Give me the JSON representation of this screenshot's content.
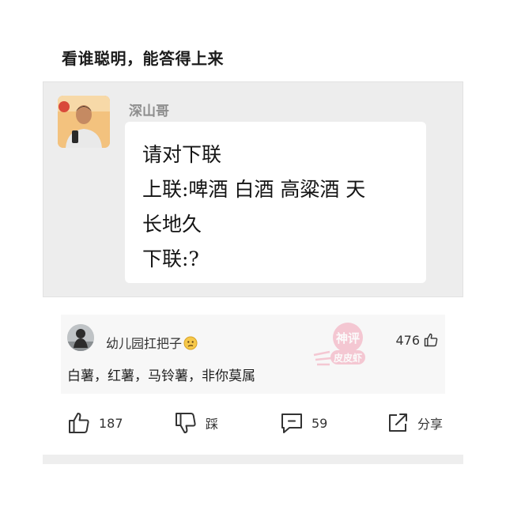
{
  "post": {
    "title": "看谁聪明，能答得上来"
  },
  "chat": {
    "sender_name": "深山哥",
    "avatar_icon": "man-avatar",
    "lines": [
      "请对下联",
      "上联:啤酒 白酒 高粱酒 天",
      "长地久",
      "下联:?"
    ]
  },
  "comment": {
    "avatar_icon": "user-avatar",
    "username": "幼儿园扛把子",
    "username_emoji": "confused-face-emoji",
    "text": "白薯，红薯，马铃薯，非你莫属",
    "likes": "476",
    "watermark_text_top": "神评",
    "watermark_text_bottom": "皮皮虾",
    "watermark_color": "#f2a0b4"
  },
  "actions": {
    "like_count": "187",
    "dislike_label": "踩",
    "comment_count": "59",
    "share_label": "分享"
  }
}
